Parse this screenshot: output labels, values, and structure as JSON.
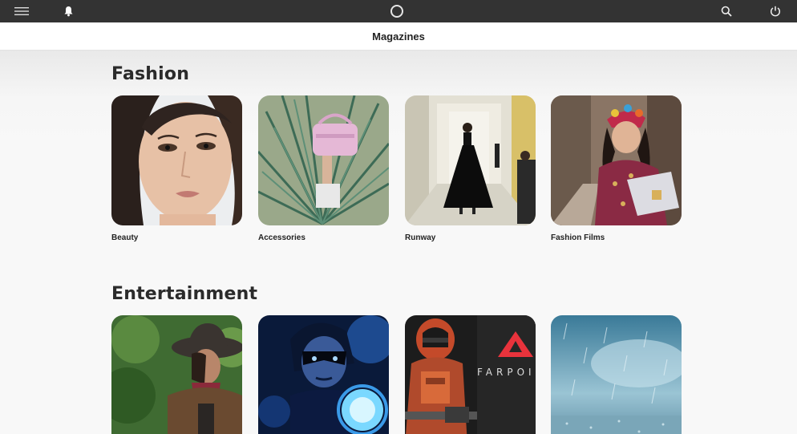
{
  "topbar": {
    "icons": [
      "hamburger-menu-icon",
      "bell-icon",
      "home-circle-icon",
      "search-icon",
      "power-icon"
    ]
  },
  "header": {
    "title": "Magazines"
  },
  "sections": [
    {
      "title": "Fashion",
      "tiles": [
        {
          "label": "Beauty",
          "image": "woman-portrait"
        },
        {
          "label": "Accessories",
          "image": "pink-handbag-palm-leaves"
        },
        {
          "label": "Runway",
          "image": "runway-model-black-dress"
        },
        {
          "label": "Fashion Films",
          "image": "woman-colorful-headscarf-street"
        }
      ]
    },
    {
      "title": "Entertainment",
      "tiles": [
        {
          "label": "",
          "image": "woman-cowboy-hat"
        },
        {
          "label": "",
          "image": "woman-blue-face-paint"
        },
        {
          "label": "",
          "image": "astronaut-farpoint-logo",
          "logo_text": "FARPOI"
        },
        {
          "label": "",
          "image": "rain-blue-sky"
        }
      ]
    }
  ],
  "colors": {
    "topbar_bg": "#333333",
    "farpoint_red": "#e8333c"
  }
}
